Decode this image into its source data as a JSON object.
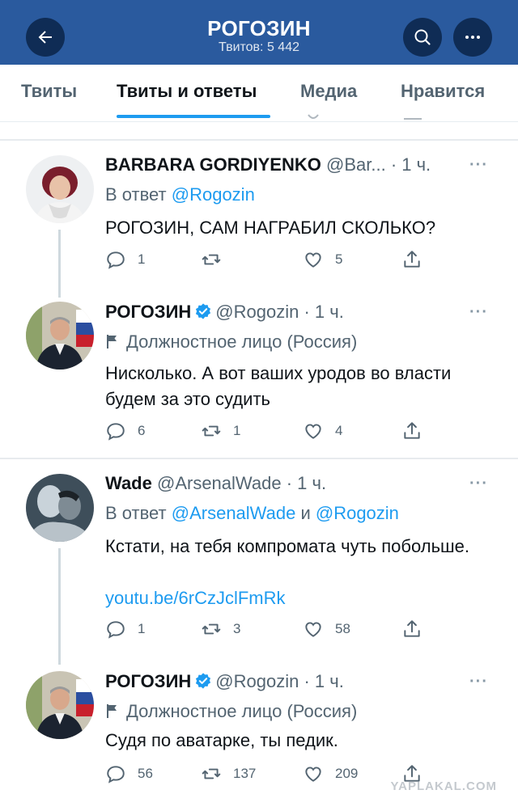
{
  "header": {
    "title": "РОГОЗИН",
    "subtitle": "Твитов: 5 442"
  },
  "tabs": [
    {
      "label": "Твиты",
      "active": false
    },
    {
      "label": "Твиты и ответы",
      "active": true
    },
    {
      "label": "Медиа",
      "active": false
    },
    {
      "label": "Нравится",
      "active": false
    }
  ],
  "tweets": [
    {
      "name": "BARBARA GORDIYENKO",
      "handle": "@Bar...",
      "time": "· 1 ч.",
      "reply_prefix": "В ответ ",
      "reply_to": "@Rogozin",
      "text": "РОГОЗИН, САМ НАГРАБИЛ СКОЛЬКО?",
      "replies": "1",
      "retweets": "",
      "likes": "5"
    },
    {
      "name": "РОГОЗИН",
      "handle": "@Rogozin",
      "time": "· 1 ч.",
      "label": "Должностное лицо (Россия)",
      "text": "Нисколько. А вот ваших уродов во власти будем за это судить",
      "replies": "6",
      "retweets": "1",
      "likes": "4"
    },
    {
      "name": "Wade",
      "handle": "@ArsenalWade",
      "time": "· 1 ч.",
      "reply_prefix": "В ответ ",
      "reply_to": "@ArsenalWade",
      "reply_and": " и ",
      "reply_to2": "@Rogozin",
      "text": "Кстати, на тебя компромата чуть побольше.",
      "link": "youtu.be/6rCzJclFmRk",
      "replies": "1",
      "retweets": "3",
      "likes": "58"
    },
    {
      "name": "РОГОЗИН",
      "handle": "@Rogozin",
      "time": "· 1 ч.",
      "label": "Должностное лицо (Россия)",
      "text": "Судя по аватарке, ты педик.",
      "replies": "56",
      "retweets": "137",
      "likes": "209"
    }
  ],
  "more_label": "···",
  "watermark": "YAPLAKAL.COM",
  "colors": {
    "header_bg": "#2a5a9e",
    "header_button": "#0f2c55",
    "accent": "#1d9bf0",
    "verified": "#1d9bf0",
    "muted": "#536471"
  },
  "icons": [
    "back-arrow-icon",
    "search-icon",
    "more-icon",
    "reply-icon",
    "retweet-icon",
    "like-icon",
    "share-icon",
    "verified-icon",
    "flag-icon"
  ]
}
